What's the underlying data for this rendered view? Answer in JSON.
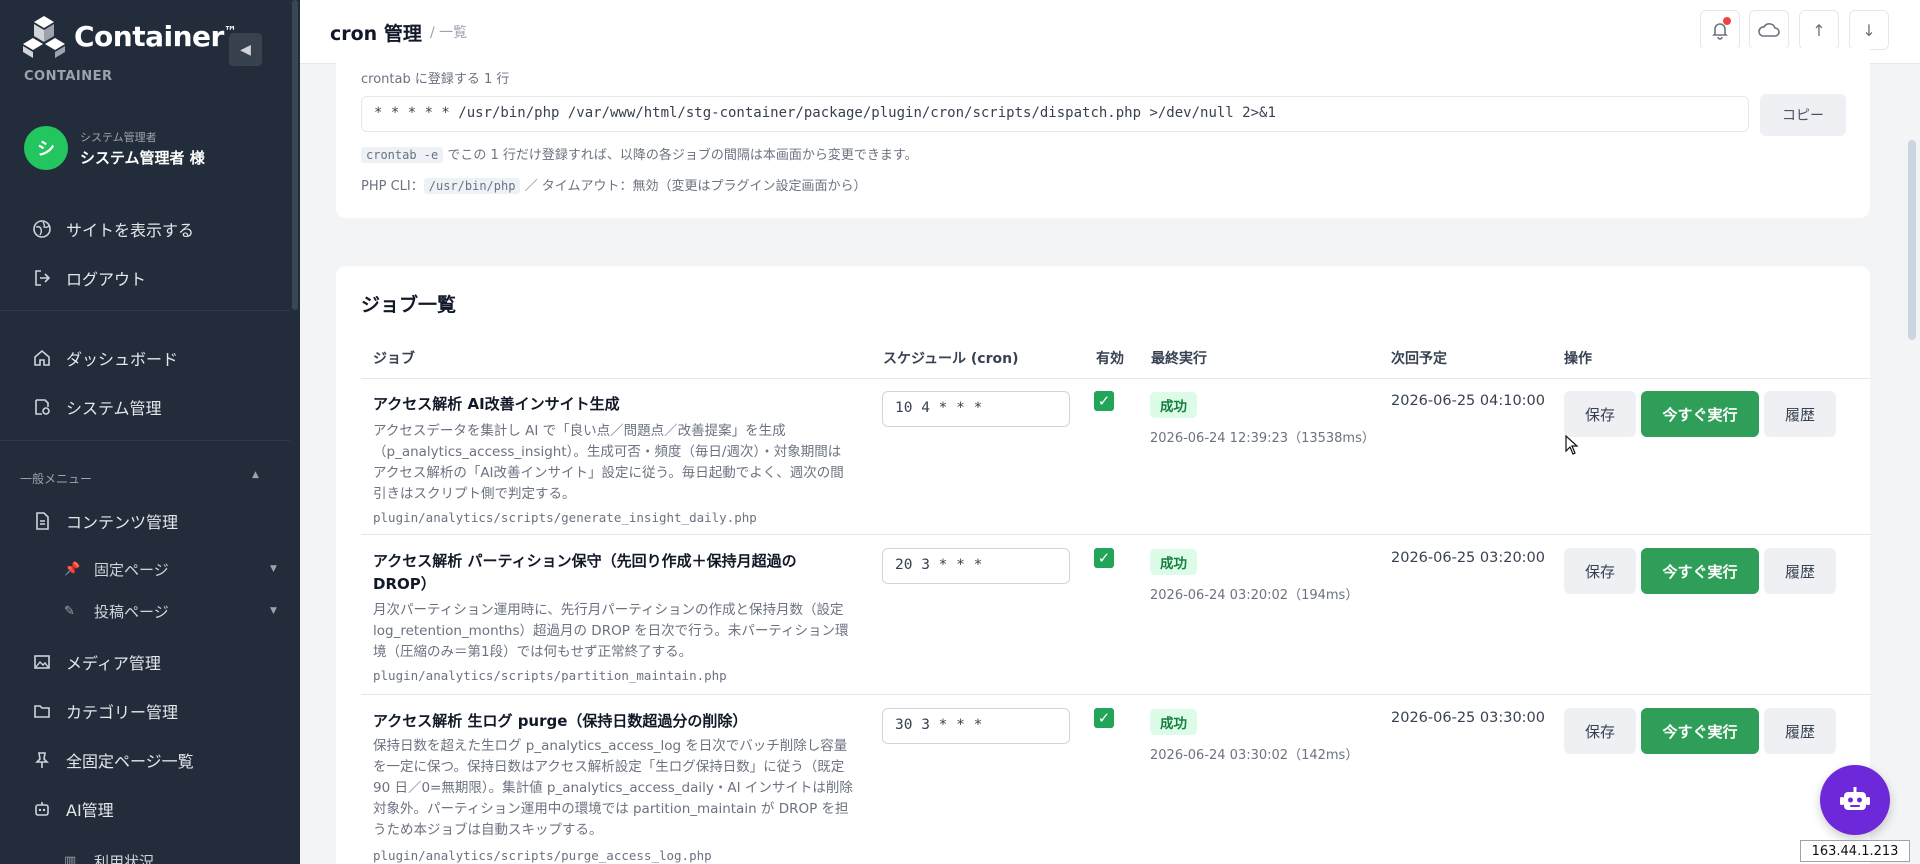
{
  "sidebar": {
    "brand": "Container",
    "brand_tm": "™",
    "brand_sub": "CONTAINER",
    "collapse": "◀",
    "user": {
      "avatar": "シ",
      "role": "システム管理者",
      "name": "システム管理者 様"
    },
    "top_links": [
      {
        "label": "サイトを表示する",
        "icon": "globe-icon"
      },
      {
        "label": "ログアウト",
        "icon": "logout-icon"
      }
    ],
    "main_links": [
      {
        "label": "ダッシュボード",
        "icon": "home-icon"
      },
      {
        "label": "システム管理",
        "icon": "system-gear-icon"
      }
    ],
    "section_label": "一般メニュー",
    "menu": {
      "contents": "コンテンツ管理",
      "fixed_pages": "固定ページ",
      "posts": "投稿ページ",
      "media": "メディア管理",
      "categories": "カテゴリー管理",
      "all_fixed": "全固定ページ一覧",
      "ai": "AI管理",
      "usage": "利用状況"
    }
  },
  "header": {
    "title": "cron 管理",
    "crumb": "/ 一覧",
    "buttons": [
      "bell-icon",
      "cloud-icon",
      "arrow-up-icon",
      "arrow-down-icon"
    ],
    "up": "↑",
    "down": "↓"
  },
  "crontab": {
    "label": "crontab に登録する 1 行",
    "line": "* * * * * /usr/bin/php /var/www/html/stg-container/package/plugin/cron/scripts/dispatch.php >/dev/null 2>&1",
    "copy": "コピー",
    "help1_code": "crontab -e",
    "help1_text": "でこの 1 行だけ登録すれば、以降の各ジョブの間隔は本画面から変更できます。",
    "help2_prefix": "PHP CLI：",
    "help2_code": "/usr/bin/php",
    "help2_suffix": "／ タイムアウト：無効（変更はプラグイン設定画面から）"
  },
  "jobs": {
    "title": "ジョブ一覧",
    "headers": {
      "job": "ジョブ",
      "schedule": "スケジュール (cron)",
      "enabled": "有効",
      "last": "最終実行",
      "next": "次回予定",
      "ops": "操作"
    },
    "buttons": {
      "save": "保存",
      "run": "今すぐ実行",
      "history": "履歴"
    },
    "rows": [
      {
        "name": "アクセス解析 AI改善インサイト生成",
        "desc": "アクセスデータを集計し AI で「良い点／問題点／改善提案」を生成（p_analytics_access_insight）。生成可否・頻度（毎日/週次）・対象期間はアクセス解析の「AI改善インサイト」設定に従う。毎日起動でよく、週次の間引きはスクリプト側で判定する。",
        "script": "plugin/analytics/scripts/generate_insight_daily.php",
        "schedule": "10 4 * * *",
        "status": "成功",
        "last": "2026-06-24 12:39:23（13538ms）",
        "next": "2026-06-25 04:10:00"
      },
      {
        "name": "アクセス解析 パーティション保守（先回り作成＋保持月超過の DROP）",
        "desc": "月次パーティション運用時に、先行月パーティションの作成と保持月数（設定 log_retention_months）超過月の DROP を日次で行う。未パーティション環境（圧縮のみ＝第1段）では何もせず正常終了する。",
        "script": "plugin/analytics/scripts/partition_maintain.php",
        "schedule": "20 3 * * *",
        "status": "成功",
        "last": "2026-06-24 03:20:02（194ms）",
        "next": "2026-06-25 03:20:00"
      },
      {
        "name": "アクセス解析 生ログ purge（保持日数超過分の削除）",
        "desc": "保持日数を超えた生ログ p_analytics_access_log を日次でバッチ削除し容量を一定に保つ。保持日数はアクセス解析設定「生ログ保持日数」に従う（既定 90 日／0=無期限）。集計値 p_analytics_access_daily・AI インサイトは削除対象外。パーティション運用中の環境では partition_maintain が DROP を担うため本ジョブは自動スキップする。",
        "script": "plugin/analytics/scripts/purge_access_log.php",
        "schedule": "30 3 * * *",
        "status": "成功",
        "last": "2026-06-24 03:30:02（142ms）",
        "next": "2026-06-25 03:30:00"
      }
    ]
  },
  "ip_badge": "163.44.1.213",
  "checkmark": "✓",
  "colors": {
    "sidebar": "#222c3a",
    "accent_green": "#2f9e58",
    "success_bg": "#dcfce7",
    "robot": "#6d28d9"
  }
}
